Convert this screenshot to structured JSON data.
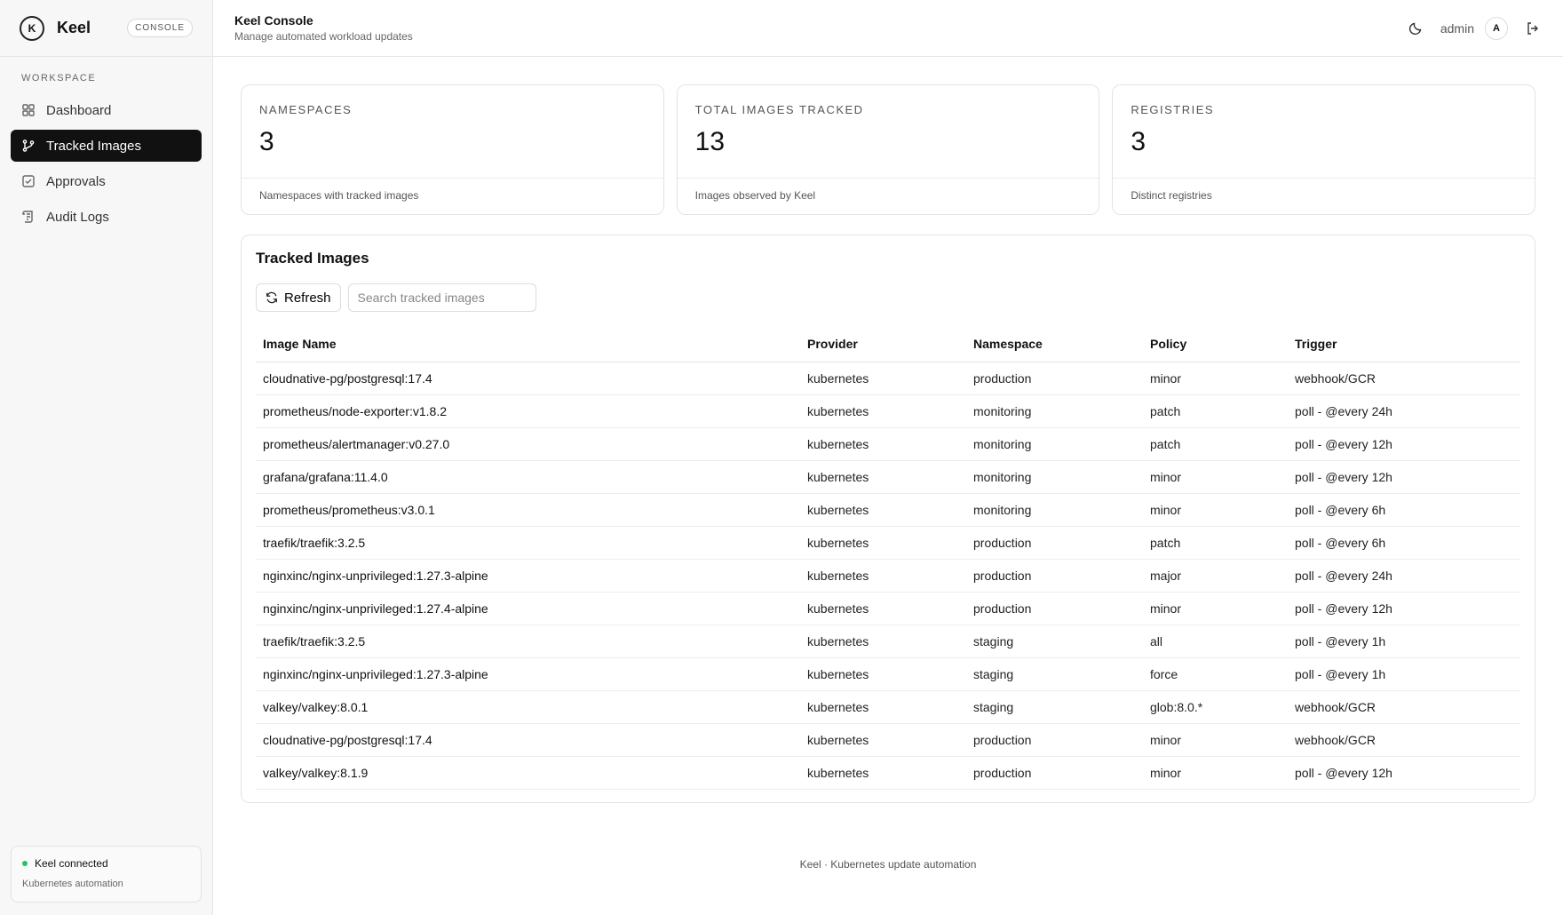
{
  "brand": {
    "name": "Keel",
    "badge": "CONSOLE",
    "logo_letter": "K"
  },
  "sidebar": {
    "section_label": "WORKSPACE",
    "items": [
      {
        "label": "Dashboard",
        "icon": "grid-icon",
        "active": false
      },
      {
        "label": "Tracked Images",
        "icon": "git-branch-icon",
        "active": true
      },
      {
        "label": "Approvals",
        "icon": "check-square-icon",
        "active": false
      },
      {
        "label": "Audit Logs",
        "icon": "scroll-icon",
        "active": false
      }
    ],
    "status": {
      "title": "Keel connected",
      "subtitle": "Kubernetes automation",
      "color": "#22c55e"
    }
  },
  "header": {
    "title": "Keel Console",
    "subtitle": "Manage automated workload updates",
    "user": "admin",
    "avatar": "A"
  },
  "stats": [
    {
      "label": "NAMESPACES",
      "value": "3",
      "description": "Namespaces with tracked images"
    },
    {
      "label": "TOTAL IMAGES TRACKED",
      "value": "13",
      "description": "Images observed by Keel"
    },
    {
      "label": "REGISTRIES",
      "value": "3",
      "description": "Distinct registries"
    }
  ],
  "panel": {
    "title": "Tracked Images",
    "refresh_label": "Refresh",
    "search_placeholder": "Search tracked images",
    "columns": [
      "Image Name",
      "Provider",
      "Namespace",
      "Policy",
      "Trigger"
    ],
    "rows": [
      [
        "cloudnative-pg/postgresql:17.4",
        "kubernetes",
        "production",
        "minor",
        "webhook/GCR"
      ],
      [
        "prometheus/node-exporter:v1.8.2",
        "kubernetes",
        "monitoring",
        "patch",
        "poll - @every 24h"
      ],
      [
        "prometheus/alertmanager:v0.27.0",
        "kubernetes",
        "monitoring",
        "patch",
        "poll - @every 12h"
      ],
      [
        "grafana/grafana:11.4.0",
        "kubernetes",
        "monitoring",
        "minor",
        "poll - @every 12h"
      ],
      [
        "prometheus/prometheus:v3.0.1",
        "kubernetes",
        "monitoring",
        "minor",
        "poll - @every 6h"
      ],
      [
        "traefik/traefik:3.2.5",
        "kubernetes",
        "production",
        "patch",
        "poll - @every 6h"
      ],
      [
        "nginxinc/nginx-unprivileged:1.27.3-alpine",
        "kubernetes",
        "production",
        "major",
        "poll - @every 24h"
      ],
      [
        "nginxinc/nginx-unprivileged:1.27.4-alpine",
        "kubernetes",
        "production",
        "minor",
        "poll - @every 12h"
      ],
      [
        "traefik/traefik:3.2.5",
        "kubernetes",
        "staging",
        "all",
        "poll - @every 1h"
      ],
      [
        "nginxinc/nginx-unprivileged:1.27.3-alpine",
        "kubernetes",
        "staging",
        "force",
        "poll - @every 1h"
      ],
      [
        "valkey/valkey:8.0.1",
        "kubernetes",
        "staging",
        "glob:8.0.*",
        "webhook/GCR"
      ],
      [
        "cloudnative-pg/postgresql:17.4",
        "kubernetes",
        "production",
        "minor",
        "webhook/GCR"
      ],
      [
        "valkey/valkey:8.1.9",
        "kubernetes",
        "production",
        "minor",
        "poll - @every 12h"
      ]
    ]
  },
  "footer": "Keel · Kubernetes update automation"
}
